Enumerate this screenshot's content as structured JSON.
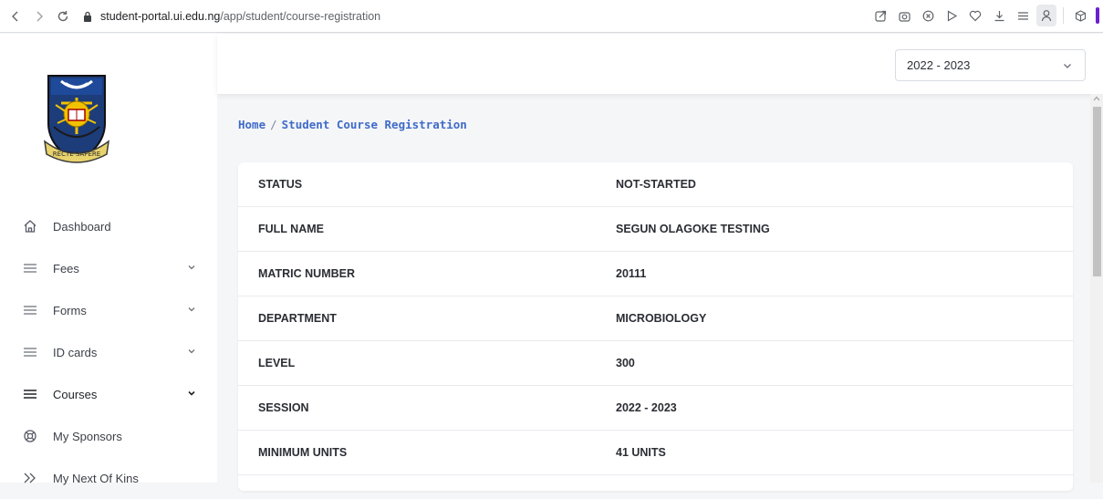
{
  "browser": {
    "url_host": "student-portal.ui.edu.ng",
    "url_path": "/app/student/course-registration",
    "icons": [
      "back-icon",
      "forward-icon",
      "reload-icon",
      "lock-icon",
      "share-icon",
      "camera-icon",
      "shield-icon",
      "play-icon",
      "heart-icon",
      "download-icon",
      "menu-icon",
      "profile-icon",
      "cube-icon"
    ],
    "accent_color": "#6a1fd1"
  },
  "header": {
    "session_selected": "2022 - 2023"
  },
  "sidebar": {
    "items": [
      {
        "label": "Dashboard",
        "icon": "home-icon",
        "has_chevron": false
      },
      {
        "label": "Fees",
        "icon": "list-icon",
        "has_chevron": true
      },
      {
        "label": "Forms",
        "icon": "list-icon",
        "has_chevron": true
      },
      {
        "label": "ID cards",
        "icon": "list-icon",
        "has_chevron": true
      },
      {
        "label": "Courses",
        "icon": "list-icon",
        "has_chevron": true,
        "active": true
      },
      {
        "label": "My Sponsors",
        "icon": "lifebuoy-icon",
        "has_chevron": false
      },
      {
        "label": "My Next Of Kins",
        "icon": "double-chevron-right-icon",
        "has_chevron": false
      }
    ]
  },
  "breadcrumb": {
    "home": "Home",
    "separator": "/",
    "current": "Student Course Registration",
    "color": "#3f6bc8"
  },
  "details": {
    "rows": [
      {
        "label": "STATUS",
        "value": "NOT-STARTED"
      },
      {
        "label": "FULL NAME",
        "value": "SEGUN OLAGOKE TESTING"
      },
      {
        "label": "MATRIC NUMBER",
        "value": "20111"
      },
      {
        "label": "DEPARTMENT",
        "value": "MICROBIOLOGY"
      },
      {
        "label": "LEVEL",
        "value": "300"
      },
      {
        "label": "SESSION",
        "value": "2022 - 2023"
      },
      {
        "label": "MINIMUM UNITS",
        "value": "41 UNITS"
      }
    ]
  }
}
